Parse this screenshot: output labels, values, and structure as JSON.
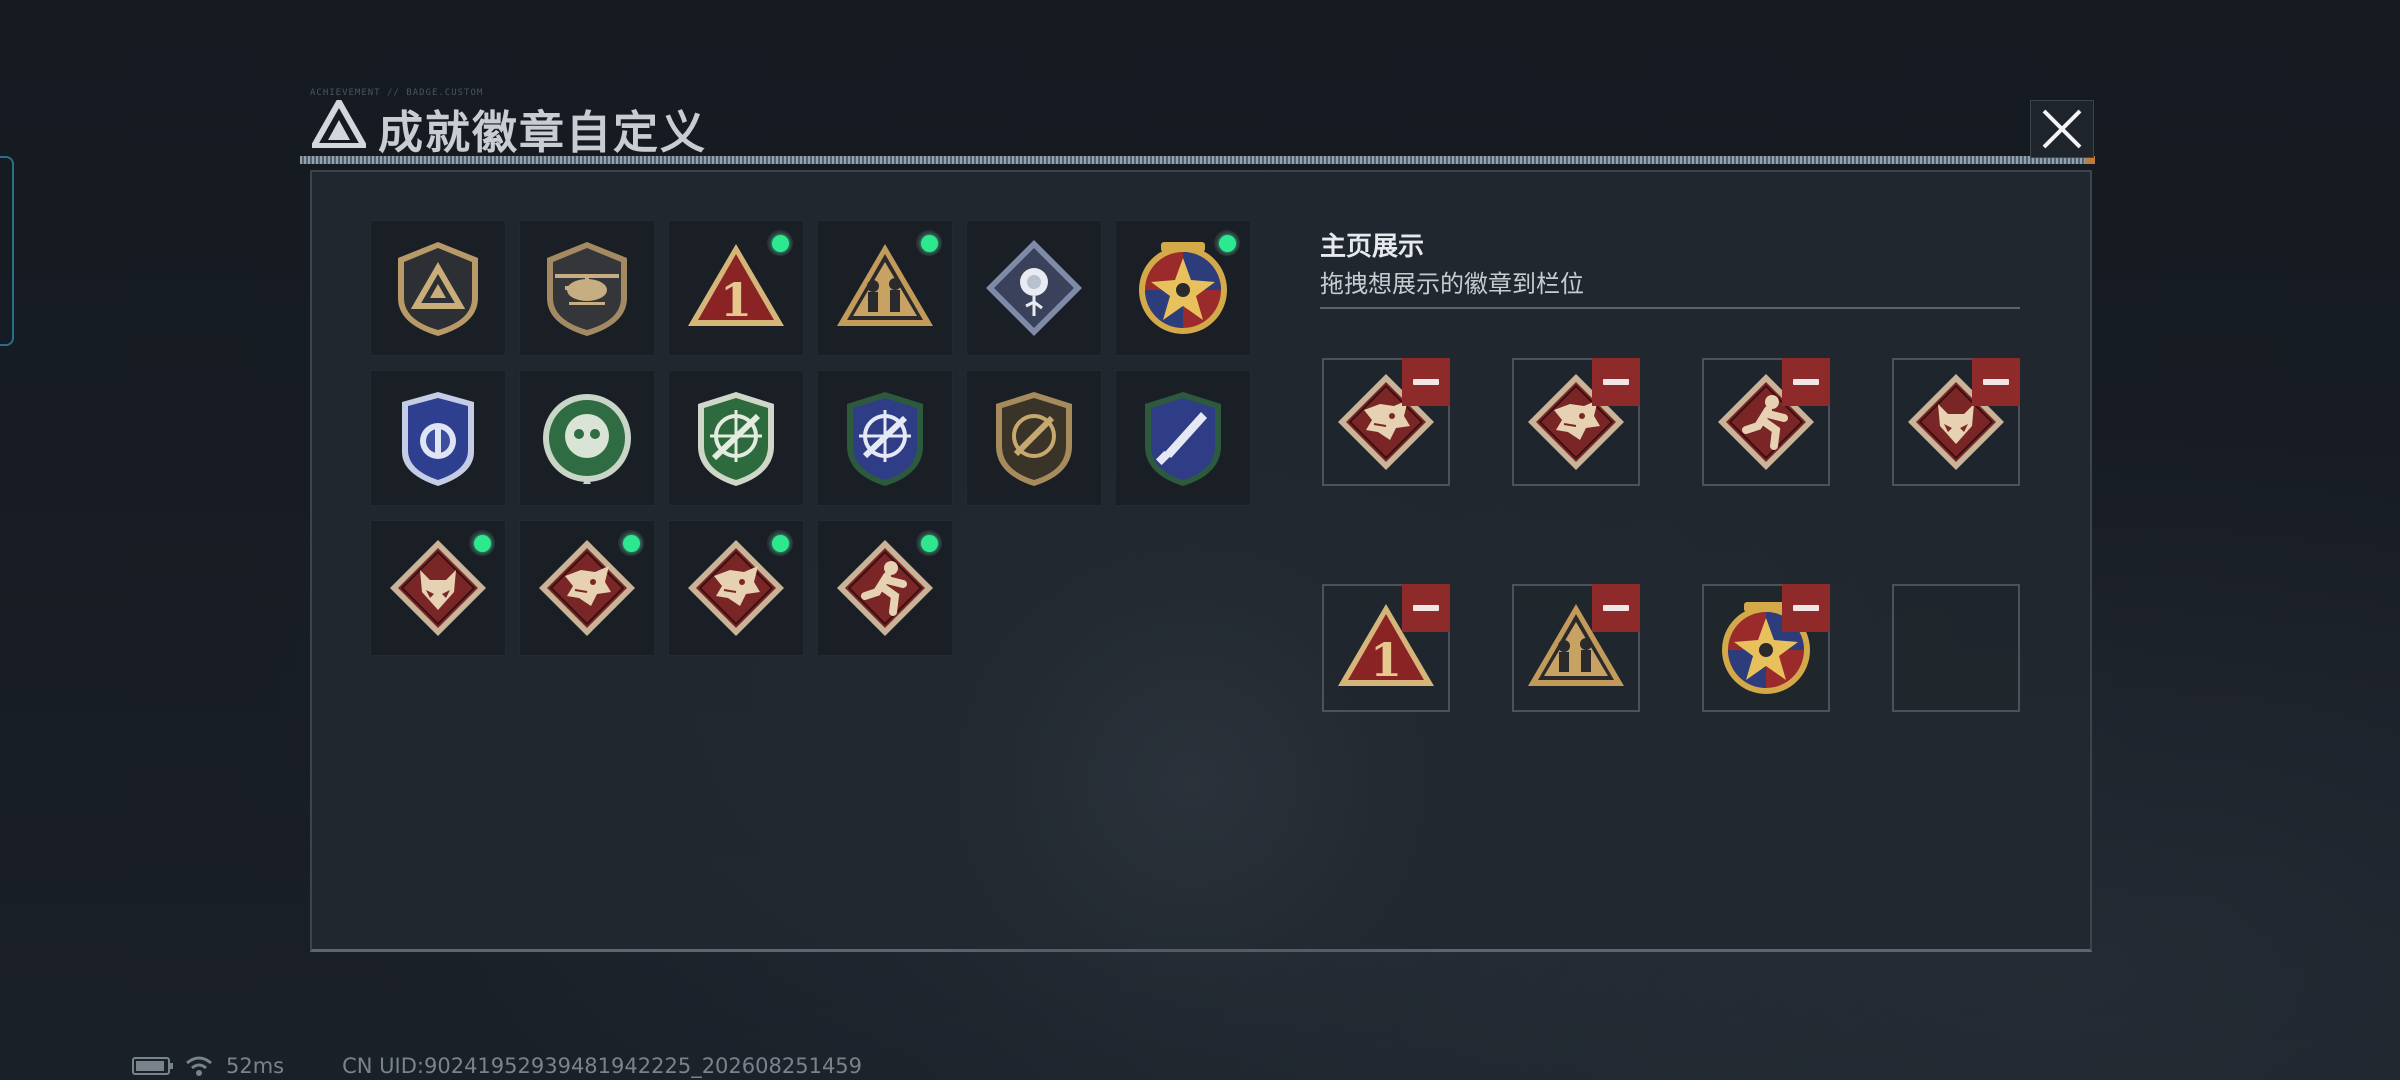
{
  "window": {
    "title": "成就徽章自定义",
    "title_deco": "ACHIEVEMENT // BADGE.CUSTOM"
  },
  "badges": [
    {
      "icon": "brand-shield-badge-icon",
      "equipped": false
    },
    {
      "icon": "helicopter-shield-badge-icon",
      "equipped": false
    },
    {
      "icon": "number-one-triangle-badge-icon",
      "equipped": true
    },
    {
      "icon": "soldiers-triangle-badge-icon",
      "equipped": true
    },
    {
      "icon": "rose-diamond-badge-icon",
      "equipped": false
    },
    {
      "icon": "star-medal-badge-icon",
      "equipped": true
    },
    {
      "icon": "blue-police-badge-icon",
      "equipped": false
    },
    {
      "icon": "green-skull-badge-icon",
      "equipped": false
    },
    {
      "icon": "green-rifle-crosshair-badge-icon",
      "equipped": false
    },
    {
      "icon": "blue-crosshair-badge-icon",
      "equipped": false
    },
    {
      "icon": "bronze-crosshair-badge-icon",
      "equipped": false
    },
    {
      "icon": "blue-knife-badge-icon",
      "equipped": false
    },
    {
      "icon": "wolf-diamond-badge-icon",
      "equipped": true
    },
    {
      "icon": "dragon-diamond-badge-icon",
      "equipped": true
    },
    {
      "icon": "dragon-diamond-badge-icon",
      "equipped": true
    },
    {
      "icon": "runner-diamond-badge-icon",
      "equipped": true
    }
  ],
  "display": {
    "title": "主页展示",
    "subtitle": "拖拽想展示的徽章到栏位",
    "slots": [
      {
        "icon": "dragon-diamond-badge-icon"
      },
      {
        "icon": "dragon-diamond-badge-icon"
      },
      {
        "icon": "runner-diamond-badge-icon"
      },
      {
        "icon": "wolf-diamond-badge-icon"
      },
      {
        "icon": "number-one-triangle-badge-icon"
      },
      {
        "icon": "soldiers-triangle-badge-icon"
      },
      {
        "icon": "star-medal-badge-icon"
      },
      {
        "icon": ""
      }
    ]
  },
  "status": {
    "ping": "52ms",
    "uid": "CN UID:90241952939481942225_202608251459"
  },
  "colors": {
    "equipped_dot": "#2ee88f",
    "remove_button": "#8e2a2a",
    "panel_bg": "#222830"
  }
}
